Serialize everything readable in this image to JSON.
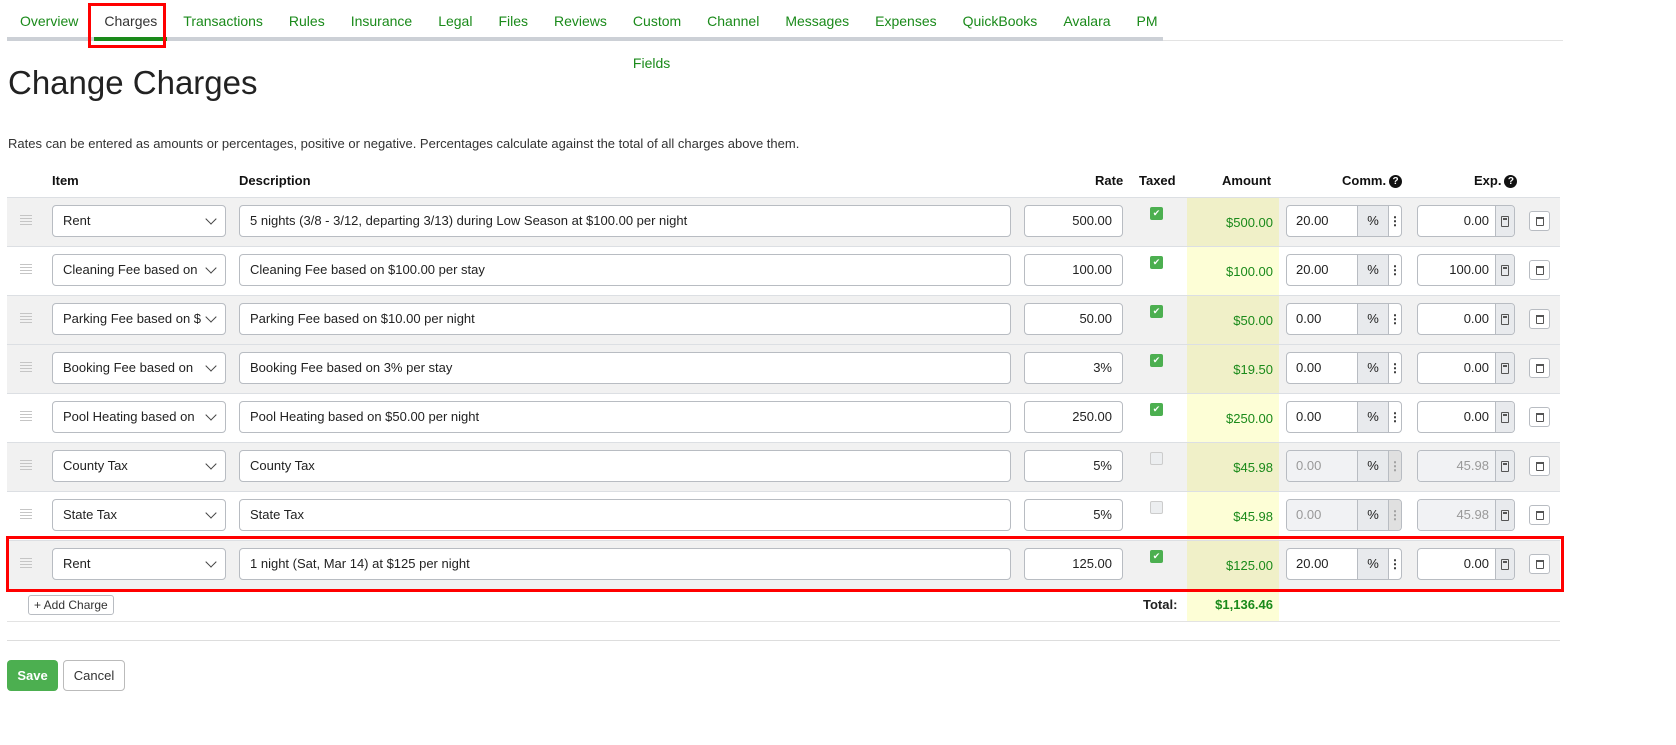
{
  "nav": {
    "tabs": [
      "Overview",
      "Charges",
      "Transactions",
      "Rules",
      "Insurance",
      "Legal",
      "Files",
      "Reviews",
      "Custom Fields",
      "Channel",
      "Messages",
      "Expenses",
      "QuickBooks",
      "Avalara",
      "PM"
    ],
    "active": "Charges"
  },
  "page": {
    "title": "Change Charges",
    "help": "Rates can be entered as amounts or percentages, positive or negative. Percentages calculate against the total of all charges above them."
  },
  "columns": {
    "item": "Item",
    "description": "Description",
    "rate": "Rate",
    "taxed": "Taxed",
    "amount": "Amount",
    "comm": "Comm.",
    "exp": "Exp."
  },
  "rows": [
    {
      "item": "Rent",
      "description": "5 nights (3/8 - 3/12, departing 3/13) during Low Season at $100.00 per night",
      "rate": "500.00",
      "taxed": true,
      "amount": "$500.00",
      "comm": "20.00",
      "comm_unit": "%",
      "exp": "0.00"
    },
    {
      "item": "Cleaning Fee based on",
      "description": "Cleaning Fee based on $100.00 per stay",
      "rate": "100.00",
      "taxed": true,
      "amount": "$100.00",
      "comm": "20.00",
      "comm_unit": "%",
      "exp": "100.00"
    },
    {
      "item": "Parking Fee based on $",
      "description": "Parking Fee based on $10.00 per night",
      "rate": "50.00",
      "taxed": true,
      "amount": "$50.00",
      "comm": "0.00",
      "comm_unit": "%",
      "exp": "0.00"
    },
    {
      "item": "Booking Fee based on",
      "description": "Booking Fee based on 3% per stay",
      "rate": "3%",
      "taxed": true,
      "amount": "$19.50",
      "comm": "0.00",
      "comm_unit": "%",
      "exp": "0.00"
    },
    {
      "item": "Pool Heating based on",
      "description": "Pool Heating based on $50.00 per night",
      "rate": "250.00",
      "taxed": true,
      "amount": "$250.00",
      "comm": "0.00",
      "comm_unit": "%",
      "exp": "0.00"
    },
    {
      "item": "County Tax",
      "description": "County Tax",
      "rate": "5%",
      "taxed": false,
      "amount": "$45.98",
      "comm": "0.00",
      "comm_unit": "%",
      "exp": "45.98"
    },
    {
      "item": "State Tax",
      "description": "State Tax",
      "rate": "5%",
      "taxed": false,
      "amount": "$45.98",
      "comm": "0.00",
      "comm_unit": "%",
      "exp": "45.98"
    },
    {
      "item": "Rent",
      "description": "1 night (Sat, Mar 14) at $125 per night",
      "rate": "125.00",
      "taxed": true,
      "amount": "$125.00",
      "comm": "20.00",
      "comm_unit": "%",
      "exp": "0.00"
    }
  ],
  "add_charge": "+ Add Charge",
  "total": {
    "label": "Total:",
    "value": "$1,136.46"
  },
  "actions": {
    "save": "Save",
    "cancel": "Cancel"
  }
}
